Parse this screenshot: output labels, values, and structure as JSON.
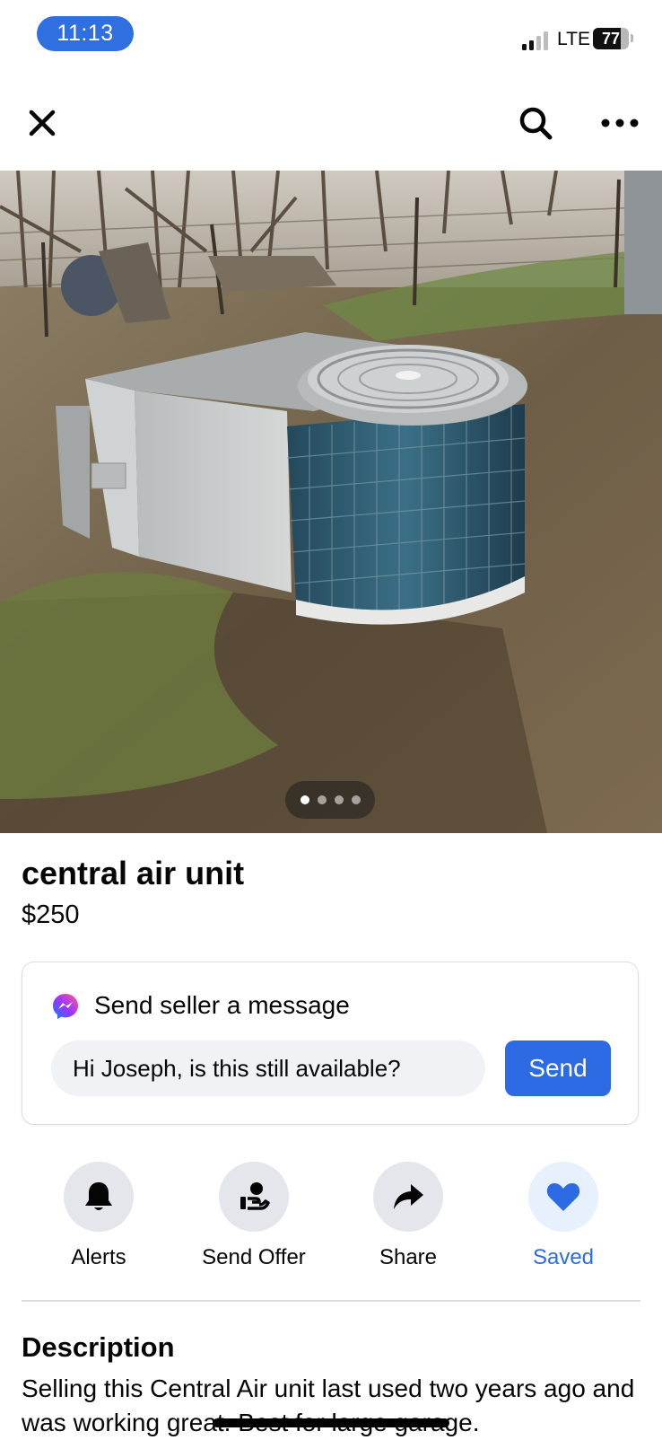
{
  "status_bar": {
    "time": "11:13",
    "network": "LTE",
    "battery": "77",
    "battery_level": 0.77,
    "signal_bars": 2,
    "accent": "#2f6fe0"
  },
  "nav": {
    "close_icon": "close-icon",
    "search_icon": "search-icon",
    "more_icon": "more-horizontal-icon"
  },
  "photo": {
    "page_count": 4,
    "current_page": 1
  },
  "listing": {
    "title": "central air unit",
    "price": "$250"
  },
  "message": {
    "heading": "Send seller a message",
    "input_value": "Hi Joseph, is this still available?",
    "send_label": "Send",
    "button_color": "#2d6be4"
  },
  "actions": [
    {
      "label": "Alerts",
      "icon": "bell-icon"
    },
    {
      "label": "Send Offer",
      "icon": "offer-icon"
    },
    {
      "label": "Share",
      "icon": "share-icon"
    },
    {
      "label": "Saved",
      "icon": "heart-icon",
      "active": true
    }
  ],
  "description": {
    "heading": "Description",
    "text": "Selling this Central Air unit last used two years ago and was working great. Best for large garage."
  }
}
